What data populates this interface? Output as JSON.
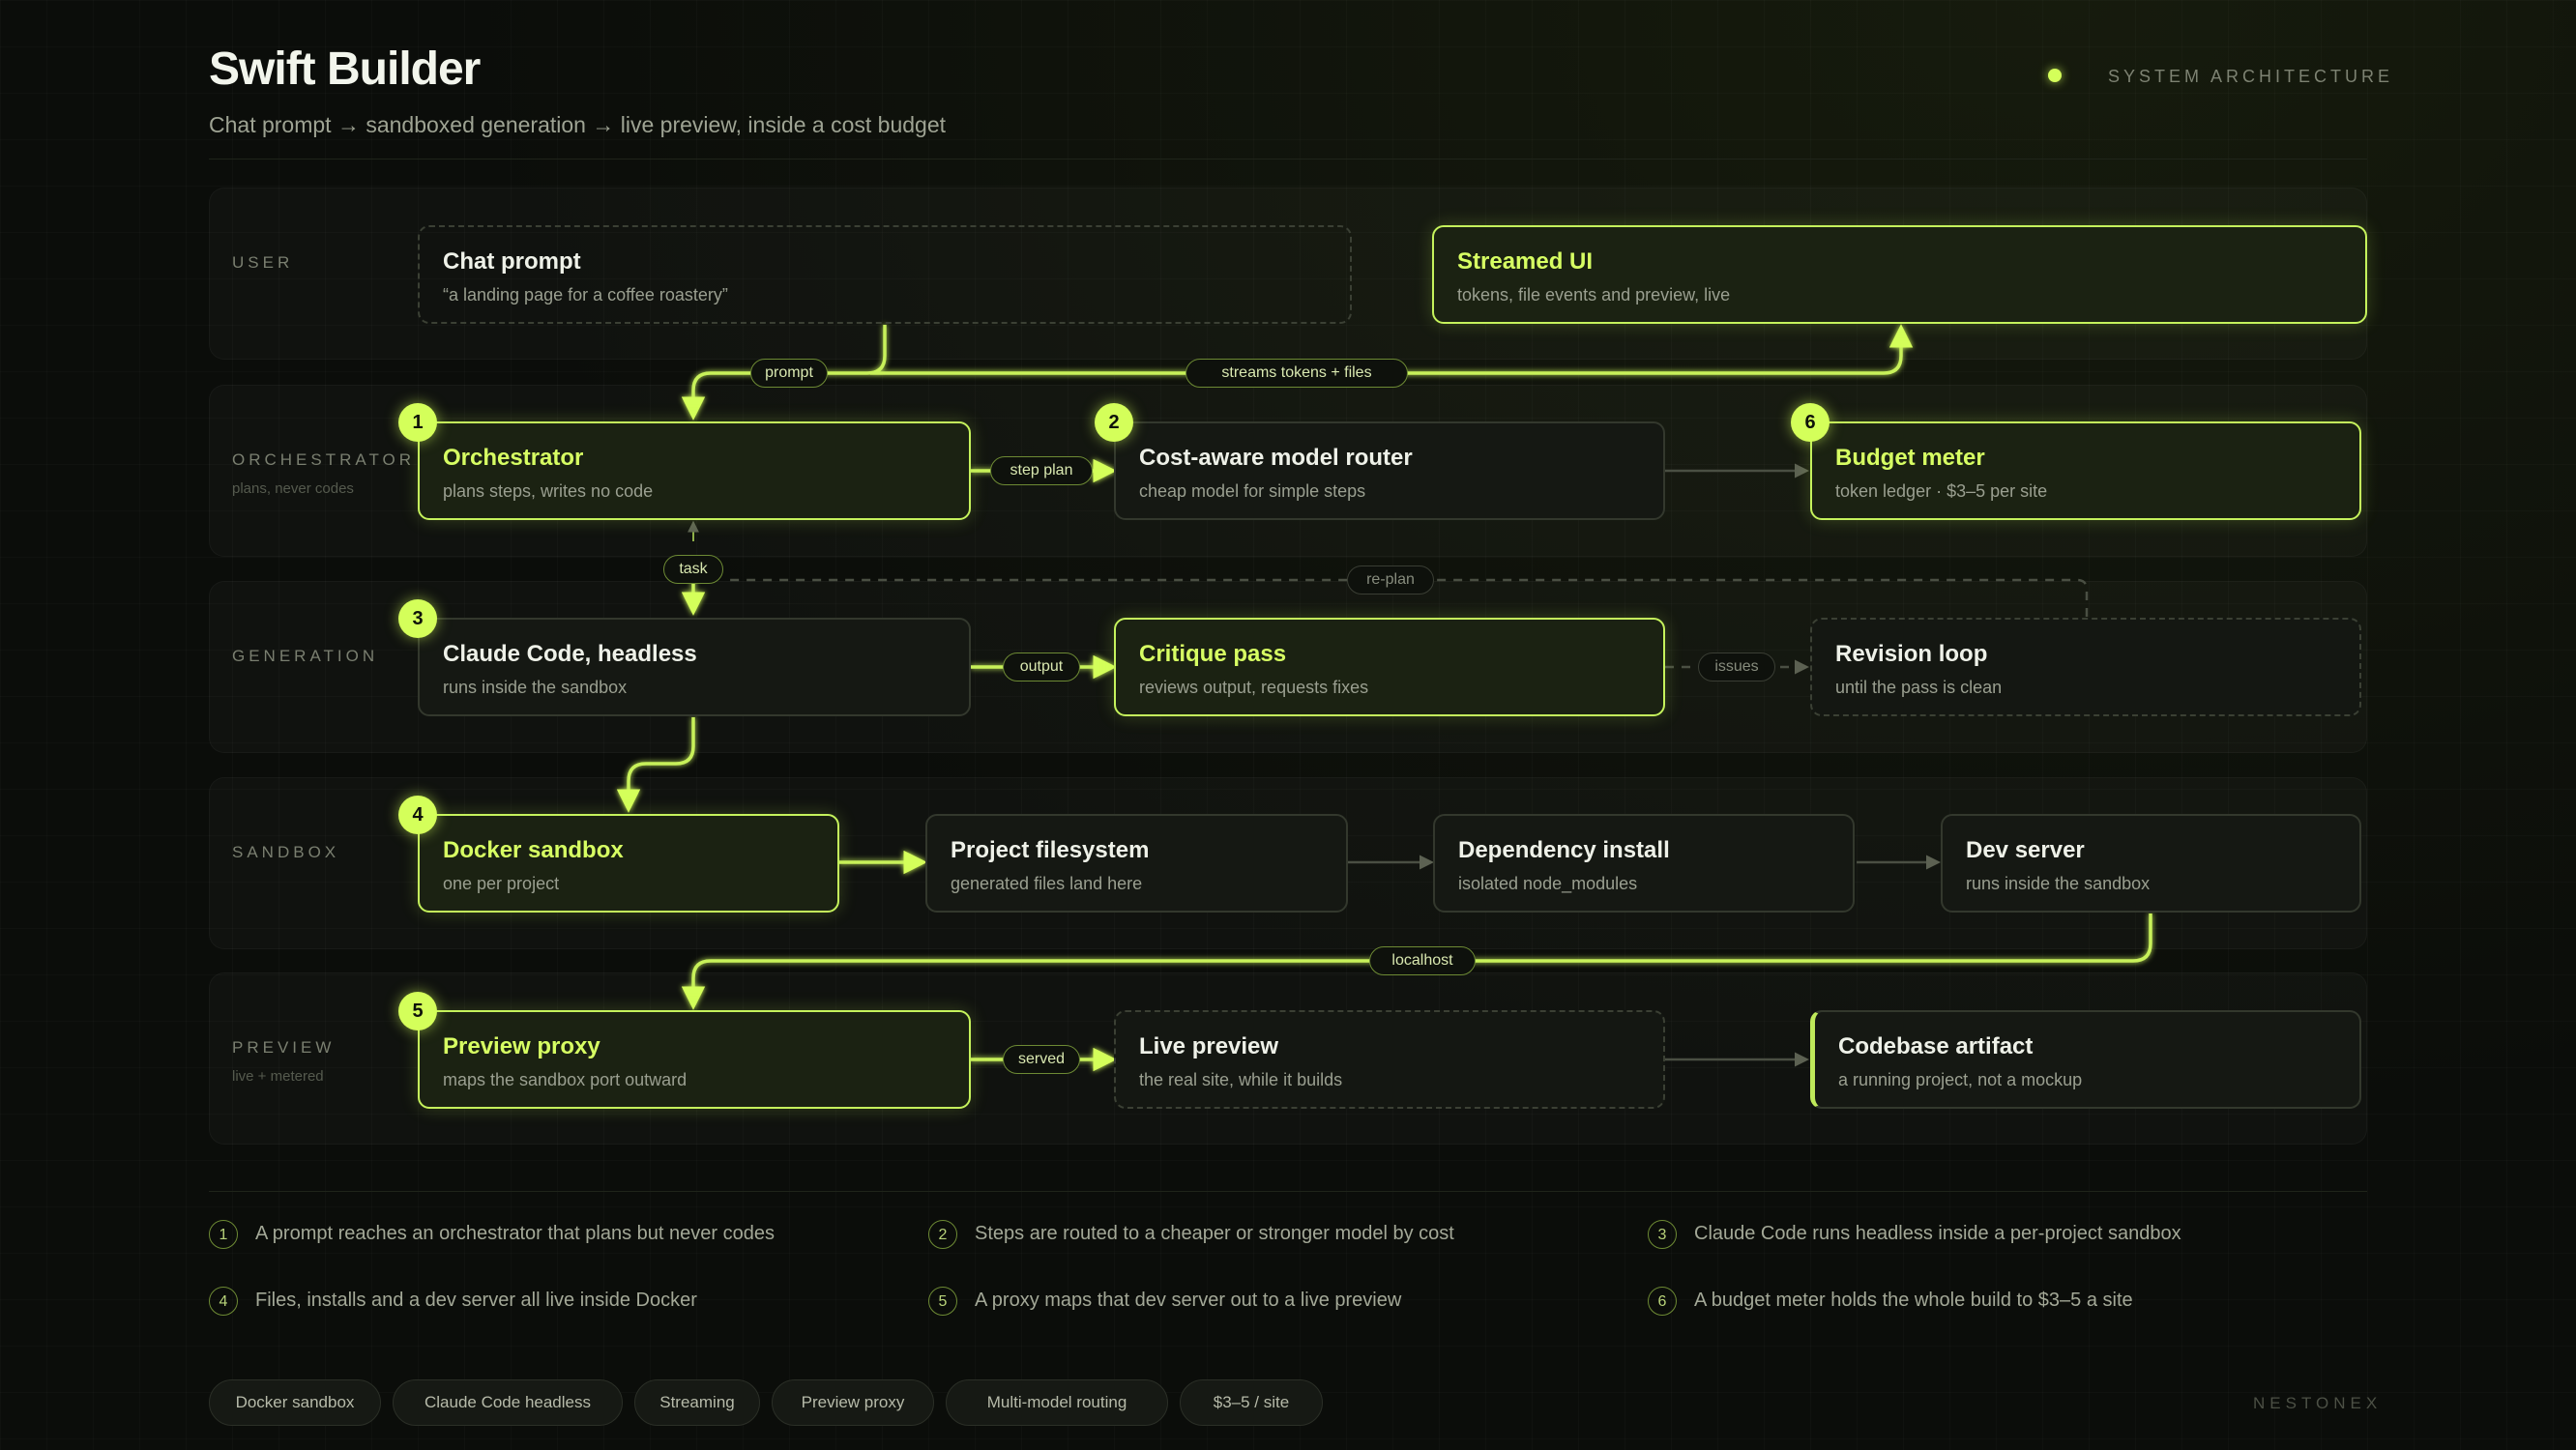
{
  "header": {
    "title": "Swift Builder",
    "subtitle": "Chat prompt → sandboxed generation → live preview, inside a cost budget",
    "tag": "SYSTEM ARCHITECTURE"
  },
  "lanes": [
    {
      "label": "USER",
      "sub": ""
    },
    {
      "label": "ORCHESTRATOR",
      "sub": "plans, never codes"
    },
    {
      "label": "GENERATION",
      "sub": ""
    },
    {
      "label": "SANDBOX",
      "sub": ""
    },
    {
      "label": "PREVIEW",
      "sub": "live + metered"
    }
  ],
  "nodes": {
    "chat_prompt": {
      "title": "Chat prompt",
      "sub": "“a landing page for a coffee roastery”"
    },
    "streamed_ui": {
      "title": "Streamed UI",
      "sub": "tokens, file events and preview, live"
    },
    "orchestrator": {
      "title": "Orchestrator",
      "sub": "plans steps, writes no code",
      "badge": "1"
    },
    "router": {
      "title": "Cost-aware model router",
      "sub": "cheap model for simple steps",
      "badge": "2"
    },
    "budget": {
      "title": "Budget meter",
      "sub": "token ledger · $3–5 per site",
      "badge": "6"
    },
    "claude": {
      "title": "Claude Code, headless",
      "sub": "runs inside the sandbox",
      "badge": "3"
    },
    "critique": {
      "title": "Critique pass",
      "sub": "reviews output, requests fixes"
    },
    "revision": {
      "title": "Revision loop",
      "sub": "until the pass is clean"
    },
    "docker": {
      "title": "Docker sandbox",
      "sub": "one per project",
      "badge": "4"
    },
    "filesystem": {
      "title": "Project filesystem",
      "sub": "generated files land here"
    },
    "deps": {
      "title": "Dependency install",
      "sub": "isolated node_modules"
    },
    "devserver": {
      "title": "Dev server",
      "sub": "runs inside the sandbox"
    },
    "proxy": {
      "title": "Preview proxy",
      "sub": "maps the sandbox port outward",
      "badge": "5"
    },
    "live": {
      "title": "Live preview",
      "sub": "the real site, while it builds"
    },
    "artifact": {
      "title": "Codebase artifact",
      "sub": "a running project, not a mockup"
    }
  },
  "edge_labels": {
    "prompt": "prompt",
    "streams": "streams tokens + files",
    "step_plan": "step plan",
    "task": "task",
    "replan": "re-plan",
    "output": "output",
    "issues": "issues",
    "localhost": "localhost",
    "served": "served"
  },
  "notes": [
    {
      "num": "1",
      "text": "A prompt reaches an orchestrator that plans but never codes"
    },
    {
      "num": "2",
      "text": "Steps are routed to a cheaper or stronger model by cost"
    },
    {
      "num": "3",
      "text": "Claude Code runs headless inside a per-project sandbox"
    },
    {
      "num": "4",
      "text": "Files, installs and a dev server all live inside Docker"
    },
    {
      "num": "5",
      "text": "A proxy maps that dev server out to a live preview"
    },
    {
      "num": "6",
      "text": "A budget meter holds the whole build to $3–5 a site"
    }
  ],
  "chips": [
    "Docker sandbox",
    "Claude Code headless",
    "Streaming",
    "Preview proxy",
    "Multi-model routing",
    "$3–5 / site"
  ],
  "brand": "NESTONEX",
  "colors": {
    "accent": "#d4ff5a",
    "background": "#0b0d0a",
    "node": "#151813",
    "muted": "#9a9f90"
  }
}
